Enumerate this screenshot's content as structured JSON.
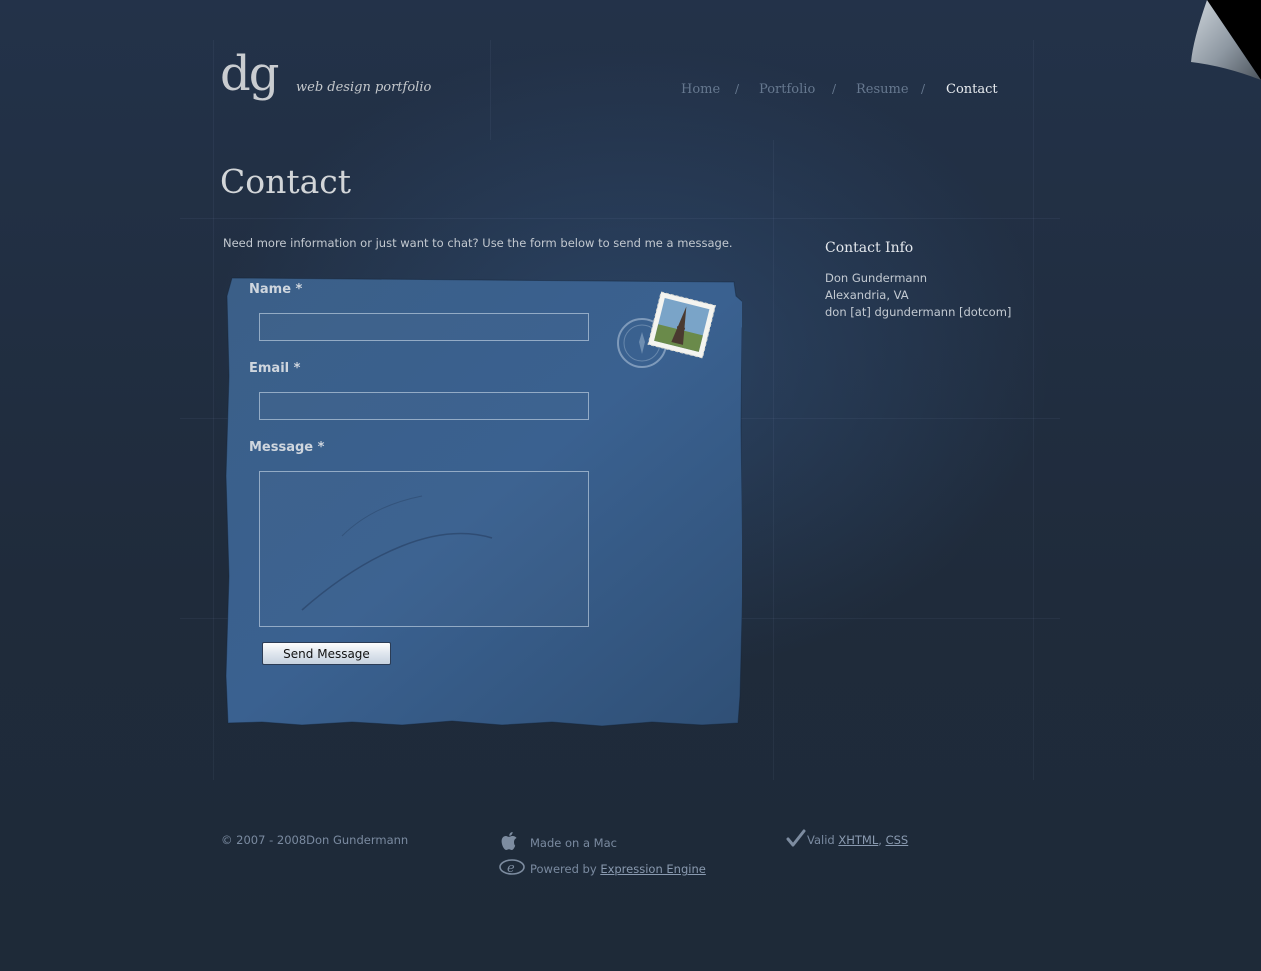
{
  "logo": {
    "monogram": "dg",
    "tagline": "web design portfolio"
  },
  "nav": {
    "items": [
      {
        "label": "Home",
        "active": false
      },
      {
        "label": "Portfolio",
        "active": false
      },
      {
        "label": "Resume",
        "active": false
      },
      {
        "label": "Contact",
        "active": true
      }
    ],
    "separator": "/"
  },
  "page": {
    "title": "Contact",
    "intro": "Need more information or just want to chat? Use the form below to send me a message."
  },
  "form": {
    "name_label": "Name *",
    "name_value": "",
    "email_label": "Email *",
    "email_value": "",
    "message_label": "Message *",
    "message_value": "",
    "submit_label": "Send Message"
  },
  "contact_info": {
    "title": "Contact Info",
    "name": "Don Gundermann",
    "location": "Alexandria, VA",
    "email": "don [at] dgundermann [dotcom]"
  },
  "footer": {
    "copyright": "© 2007 - 2008Don Gundermann",
    "made_on": "Made on a Mac",
    "powered_prefix": "Powered by ",
    "powered_link": "Expression Engine",
    "valid_prefix": "Valid ",
    "valid_xhtml": "XHTML",
    "valid_comma": ",",
    "valid_css": "CSS"
  },
  "colors": {
    "background": "#1f2b3a",
    "paper": "#3a5f88",
    "nav_inactive": "#66788f",
    "nav_active": "#e8ecf0"
  },
  "icons": [
    "apple-icon",
    "expression-engine-icon",
    "checkmark-icon",
    "stamp-icon",
    "postmark-icon",
    "page-curl-icon"
  ]
}
